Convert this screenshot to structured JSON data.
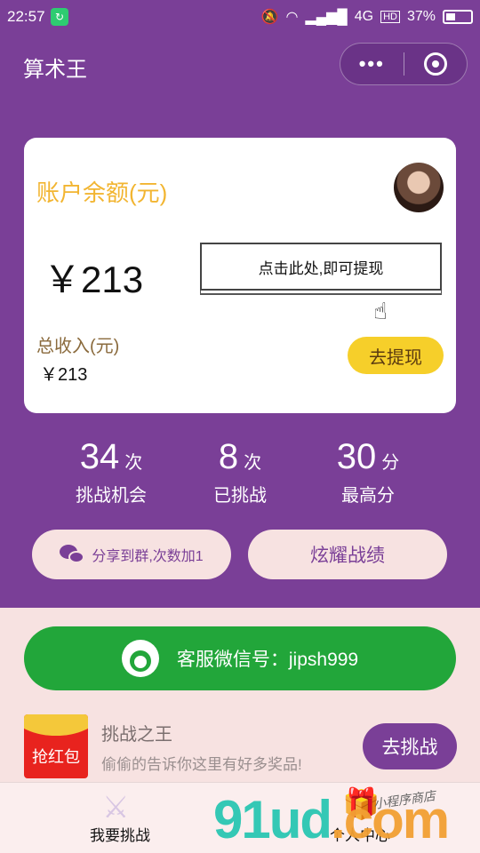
{
  "status_bar": {
    "time": "22:57",
    "network": "4G",
    "hd": "HD",
    "battery": "37%"
  },
  "header": {
    "title": "算术王",
    "more": "•••"
  },
  "card": {
    "balance_label": "账户余额(元)",
    "balance": "￥213",
    "tip": "点击此处,即可提现",
    "income_label": "总收入(元)",
    "income": "￥213",
    "withdraw_button": "去提现"
  },
  "stats": [
    {
      "value": "34",
      "unit": "次",
      "label": "挑战机会"
    },
    {
      "value": "8",
      "unit": "次",
      "label": "已挑战"
    },
    {
      "value": "30",
      "unit": "分",
      "label": "最高分"
    }
  ],
  "actions": {
    "share": "分享到群,次数加1",
    "show_off": "炫耀战绩"
  },
  "service": {
    "text": "客服微信号：jipsh999"
  },
  "challenge": {
    "badge": "抢红包",
    "title": "挑战之王",
    "description": "偷偷的告诉你这里有好多奖品!",
    "button": "去挑战"
  },
  "tabbar": {
    "tab1": "我要挑战",
    "tab2": "个人中心"
  },
  "watermark": {
    "main": "91ud",
    "suffix": ".com",
    "sub": "小程序商店"
  },
  "colors": {
    "primary": "#7a3f97",
    "accent": "#f6cf2a",
    "service_green": "#22a63a",
    "pink_bg": "#f7e2e1"
  }
}
